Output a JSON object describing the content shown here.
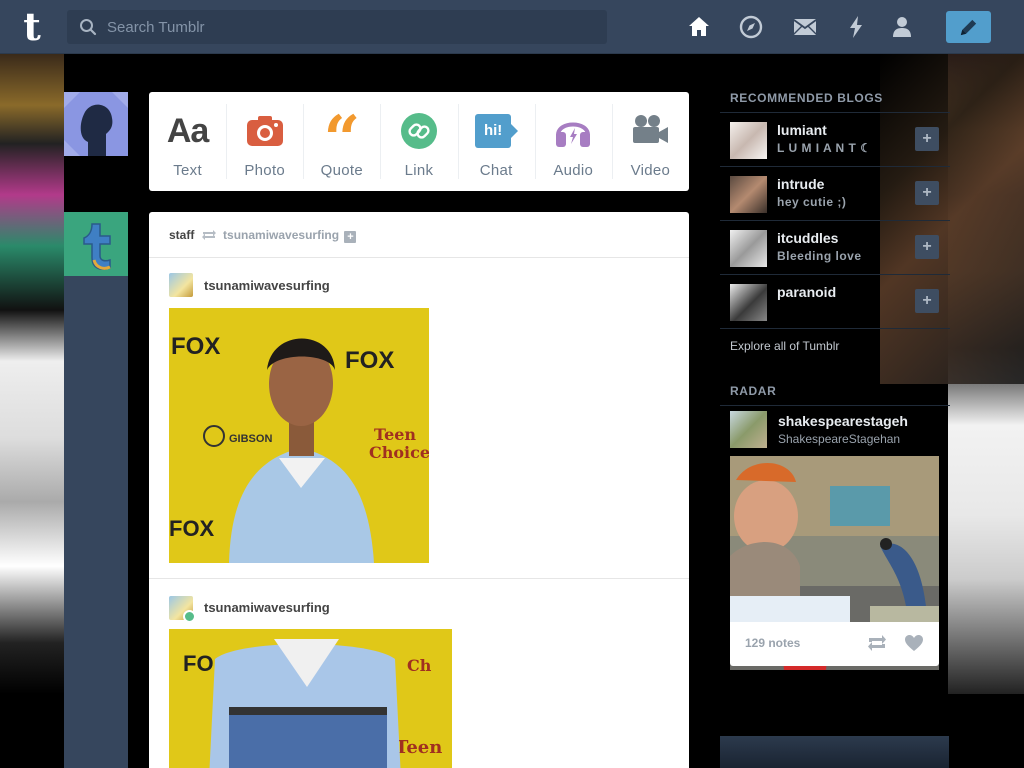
{
  "header": {
    "logo": "t",
    "search": {
      "placeholder": "Search Tumblr"
    },
    "nav": [
      "home-icon",
      "explore-compass-icon",
      "inbox-mail-icon",
      "activity-lightning-icon",
      "account-person-icon"
    ],
    "compose_icon": "pencil-icon"
  },
  "post_types": [
    {
      "label": "Text",
      "icon": "Aa",
      "color": "#444444"
    },
    {
      "label": "Photo",
      "icon": "camera-icon",
      "color": "#d95e40"
    },
    {
      "label": "Quote",
      "icon": "“",
      "color": "#f2992e"
    },
    {
      "label": "Link",
      "icon": "link-icon",
      "color": "#56bc8a"
    },
    {
      "label": "Chat",
      "icon": "hi!",
      "color": "#529ecc"
    },
    {
      "label": "Audio",
      "icon": "headphones-icon",
      "color": "#a77dc2"
    },
    {
      "label": "Video",
      "icon": "video-camera-icon",
      "color": "#748089"
    }
  ],
  "post": {
    "reblogger": "staff",
    "source": "tsunamiwavesurfing",
    "items": [
      {
        "username": "tsunamiwavesurfing"
      },
      {
        "username": "tsunamiwavesurfing"
      }
    ]
  },
  "sidebar": {
    "recommended_title": "RECOMMENDED BLOGS",
    "blogs": [
      {
        "name": "lumiant",
        "subtitle": "L U M I A N T ☾"
      },
      {
        "name": "intrude",
        "subtitle": "hey cutie ;)"
      },
      {
        "name": "itcuddles",
        "subtitle": "Bleeding love"
      },
      {
        "name": "paranoid",
        "subtitle": ""
      }
    ],
    "follow_label": "+",
    "explore_link": "Explore all of Tumblr",
    "radar_title": "RADAR",
    "radar": {
      "name": "shakespearestageh",
      "subtitle": "ShakespeareStagehan",
      "notes": "129 notes"
    }
  }
}
